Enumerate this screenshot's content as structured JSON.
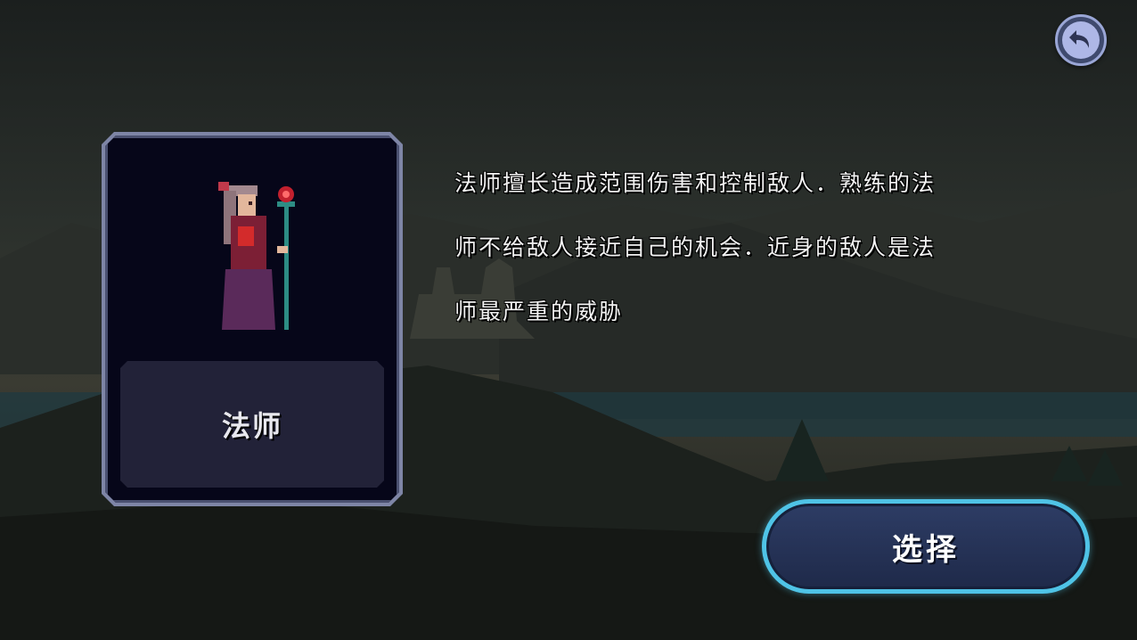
{
  "screen": "class-select",
  "back_button": {
    "icon": "undo-arrow-icon"
  },
  "character": {
    "name": "法师",
    "description_lines": [
      "法师擅长造成范围伤害和控制敌人．熟练的法",
      "师不给敌人接近自己的机会．近身的敌人是法",
      "师最严重的威胁"
    ]
  },
  "select_button": {
    "label": "选择"
  },
  "colors": {
    "card_bg": "#060619",
    "card_border": "#7e85a6",
    "button_accent": "#4fc3e6",
    "button_fill": "#2d3c64",
    "back_button": "#aeb7e6"
  }
}
